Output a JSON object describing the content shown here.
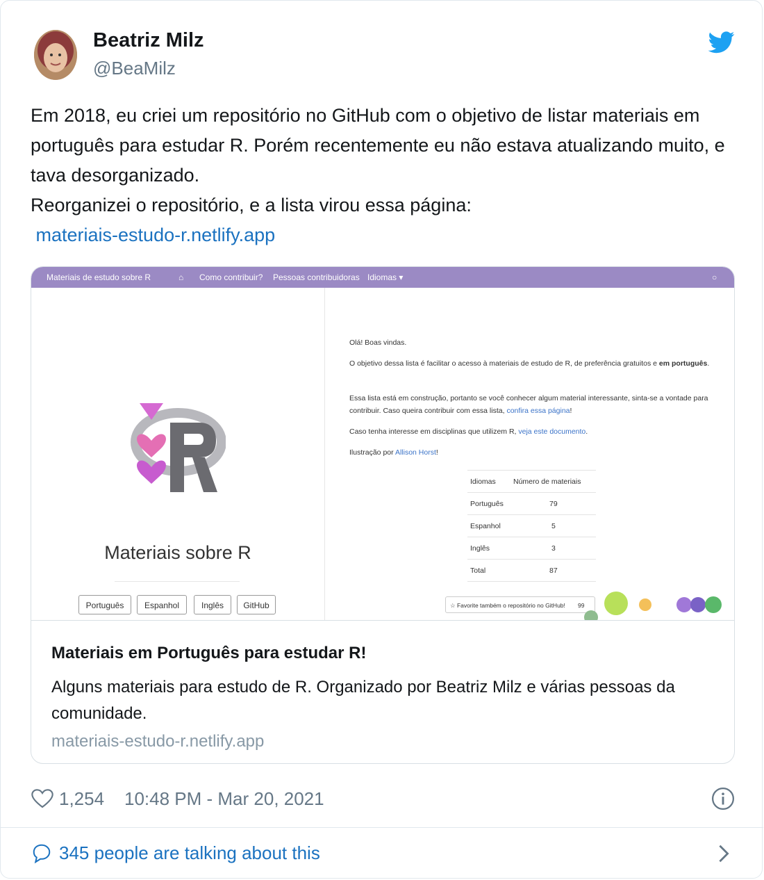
{
  "author": {
    "name": "Beatriz Milz",
    "handle": "@BeaMilz"
  },
  "tweet": {
    "lines": [
      "Em 2018, eu criei um repositório no GitHub com o objetivo de listar materiais em português para estudar R. Porém recentemente eu não estava atualizando muito, e tava desorganizado.",
      "Reorganizei o repositório, e a lista virou essa página:"
    ],
    "link": "materiais-estudo-r.netlify.app"
  },
  "preview": {
    "navbar": {
      "brand": "Materiais de estudo sobre R",
      "items": [
        "Como contribuir?",
        "Pessoas contribuidoras",
        "Idiomas ▾"
      ]
    },
    "site_title": "Materiais sobre R",
    "buttons": [
      "Português",
      "Espanhol",
      "Inglês",
      "GitHub"
    ],
    "p1": "Olá! Boas vindas.",
    "p2a": "O objetivo dessa lista é facilitar o acesso à materiais de estudo de R, de preferência gratuitos e ",
    "p2b": "em português",
    "p2c": ".",
    "p3a": "Essa lista está em construção, portanto se você conhecer algum material interessante, sinta-se a vontade para contribuir. Caso queira contribuir com essa lista, ",
    "p3link": "confira essa página",
    "p3c": "!",
    "p4a": "Caso tenha interesse em disciplinas que utilizem R, ",
    "p4link": "veja este documento",
    "p4c": ".",
    "p5a": "Ilustração por ",
    "p5link": "Allison Horst",
    "p5c": "!",
    "table": {
      "headers": [
        "Idiomas",
        "Número de materiais"
      ],
      "rows": [
        [
          "Português",
          "79"
        ],
        [
          "Espanhol",
          "5"
        ],
        [
          "Inglês",
          "3"
        ],
        [
          "Total",
          "87"
        ]
      ]
    },
    "star_button": "☆ Favorite também o repositório no GitHub!",
    "star_count": "99"
  },
  "card": {
    "title": "Materiais em Português para estudar R!",
    "description": "Alguns materiais para estudo de R. Organizado por Beatriz Milz e várias pessoas da comunidade.",
    "url": "materiais-estudo-r.netlify.app"
  },
  "meta": {
    "likes": "1,254",
    "timestamp": "10:48 PM - Mar 20, 2021"
  },
  "footer": {
    "talking": "345 people are talking about this"
  },
  "colors": {
    "link": "#1b72c0",
    "twitter_blue": "#1da1f2",
    "nav_purple": "#9b8ac4"
  }
}
